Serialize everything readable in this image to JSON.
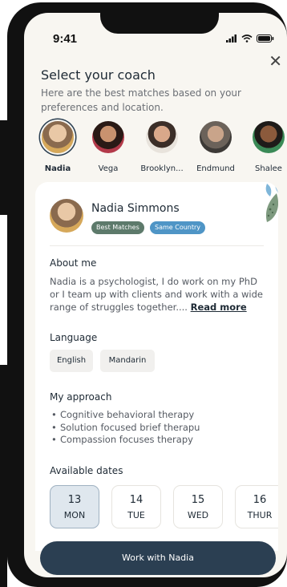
{
  "status_bar": {
    "time": "9:41"
  },
  "header": {
    "title": "Select your coach",
    "subtitle": "Here are the best matches based on your preferences and location."
  },
  "coaches": [
    {
      "name": "Nadia",
      "selected": true,
      "color": "#c9a47a"
    },
    {
      "name": "Vega",
      "selected": false,
      "color": "#7a3b2c"
    },
    {
      "name": "Brooklyn...",
      "selected": false,
      "color": "#5b4536"
    },
    {
      "name": "Endmund",
      "selected": false,
      "color": "#6b6660"
    },
    {
      "name": "Shalee",
      "selected": false,
      "color": "#3b8a57"
    }
  ],
  "profile": {
    "name": "Nadia Simmons",
    "badges": [
      {
        "label": "Best Matches",
        "color": "#5d7a6b"
      },
      {
        "label": "Same Country",
        "color": "#4f95c6"
      }
    ],
    "about_heading": "About me",
    "about_text": "Nadia is a psychologist, I do work on my PhD or I team up with clients and work with a wide range of struggles together....",
    "read_more": "Read more",
    "language_heading": "Language",
    "languages": [
      "English",
      "Mandarin"
    ],
    "approach_heading": "My approach",
    "approaches": [
      "Cognitive behavioral therapy",
      "Solution focused brief therapu",
      "Compassion focuses therapy"
    ],
    "dates_heading": "Available dates",
    "dates": [
      {
        "day": "13",
        "weekday": "MON",
        "selected": true
      },
      {
        "day": "14",
        "weekday": "TUE",
        "selected": false
      },
      {
        "day": "15",
        "weekday": "WED",
        "selected": false
      },
      {
        "day": "16",
        "weekday": "THUR",
        "selected": false
      }
    ]
  },
  "cta": {
    "label": "Work with Nadia"
  },
  "colors": {
    "primary": "#2b3f52",
    "background": "#f8f6f1"
  }
}
